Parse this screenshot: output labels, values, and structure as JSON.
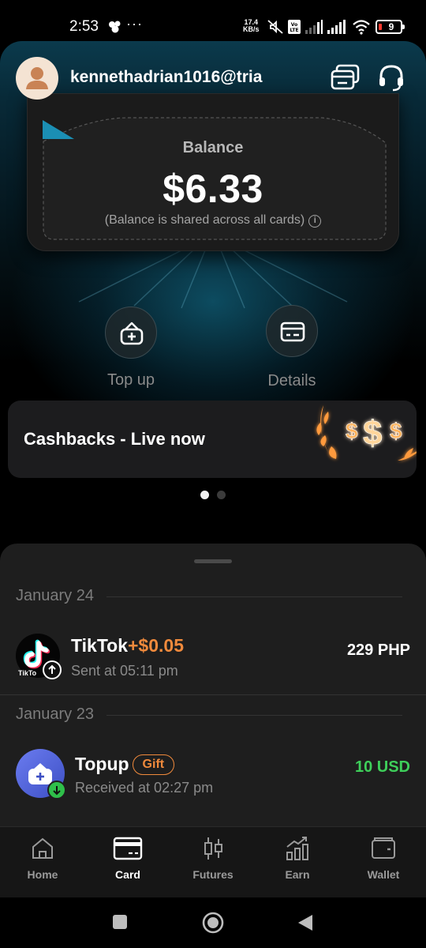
{
  "status_bar": {
    "time": "2:53",
    "network_speed_value": "17.4",
    "network_speed_unit": "KB/s",
    "battery_level": "9",
    "icons": [
      "app-notification-icon",
      "more-dots-icon",
      "mute-icon",
      "volte-icon",
      "signal-icon",
      "signal-icon",
      "wifi-icon",
      "battery-low-icon"
    ]
  },
  "header": {
    "username": "kennethadrian1016@tria",
    "icons": [
      "avatar-icon",
      "cards-icon",
      "headset-icon"
    ]
  },
  "balance": {
    "label": "Balance",
    "amount": "$6.33",
    "note": "(Balance is shared across all cards)"
  },
  "actions": [
    {
      "label": "Top up",
      "icon": "wallet-plus-icon"
    },
    {
      "label": "Details",
      "icon": "card-details-icon"
    }
  ],
  "promo": {
    "title": "Cashbacks - Live now",
    "art_text": "$$$",
    "carousel_pages": 2,
    "carousel_active": 1
  },
  "transactions": {
    "groups": [
      {
        "date": "January 24",
        "items": [
          {
            "name": "TikTok",
            "name_extra": "+$0.05",
            "subtitle": "Sent at 05:11 pm",
            "amount": "229 PHP",
            "icon_text": "TikTo",
            "direction": "sent"
          }
        ]
      },
      {
        "date": "January 23",
        "items": [
          {
            "name": "Topup",
            "tag": "Gift",
            "subtitle": "Received at 02:27 pm",
            "amount": "10 USD",
            "direction": "received"
          }
        ]
      }
    ]
  },
  "bottom_nav": {
    "items": [
      {
        "label": "Home",
        "icon": "home-icon",
        "active": false
      },
      {
        "label": "Card",
        "icon": "card-icon",
        "active": true
      },
      {
        "label": "Futures",
        "icon": "candlestick-icon",
        "active": false
      },
      {
        "label": "Earn",
        "icon": "bar-chart-up-icon",
        "active": false
      },
      {
        "label": "Wallet",
        "icon": "wallet-icon",
        "active": false
      }
    ]
  },
  "colors": {
    "accent_orange": "#f08a3c",
    "positive_green": "#3ecf5a",
    "background": "#000000",
    "sheet": "#1e1e1e"
  }
}
